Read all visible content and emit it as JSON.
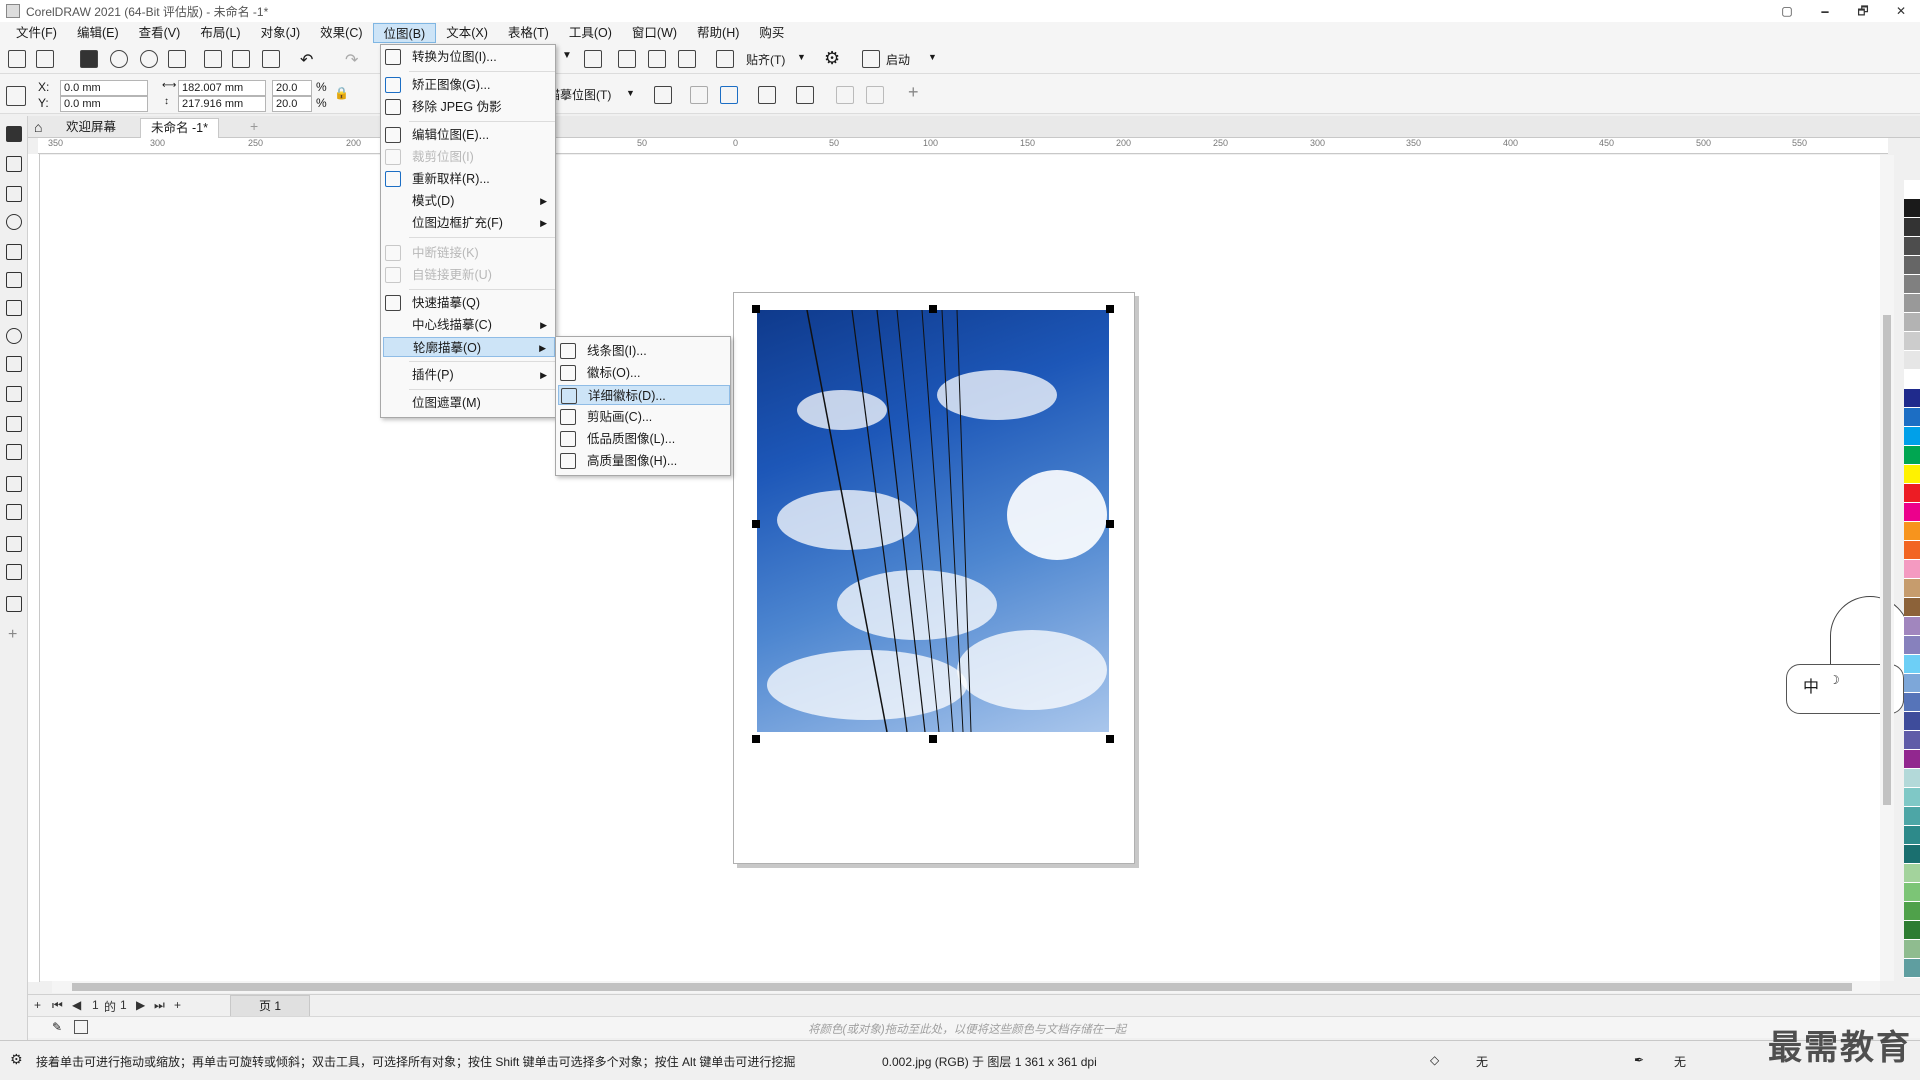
{
  "window": {
    "title": "CorelDRAW 2021 (64-Bit 评估版) - 未命名 -1*",
    "controls": [
      "🗕",
      "🗗",
      "✕"
    ]
  },
  "menubar": [
    "文件(F)",
    "编辑(E)",
    "查看(V)",
    "布局(L)",
    "对象(J)",
    "效果(C)",
    "位图(B)",
    "文本(X)",
    "表格(T)",
    "工具(O)",
    "窗口(W)",
    "帮助(H)",
    "购买"
  ],
  "toolbar1": {
    "snap_label": "贴齐(T)",
    "launch_label": "启动"
  },
  "toolbar2": {
    "x_label": "X:",
    "x_value": "0.0 mm",
    "y_label": "Y:",
    "y_value": "0.0 mm",
    "width_value": "182.007 mm",
    "height_value": "217.916 mm",
    "scale_x": "20.0",
    "scale_y": "20.0",
    "percent": "%",
    "trace_label": "描摹位图(T)"
  },
  "tabs": {
    "welcome": "欢迎屏幕",
    "document": "未命名 -1*"
  },
  "ruler_h": [
    "350",
    "300",
    "250",
    "200",
    "50",
    "0",
    "50",
    "100",
    "150",
    "200",
    "250",
    "300",
    "350",
    "400",
    "450",
    "500",
    "550"
  ],
  "bitmap_menu": {
    "items": [
      {
        "label": "转换为位图(I)...",
        "enabled": true
      },
      {
        "label": "矫正图像(G)...",
        "enabled": true
      },
      {
        "label": "移除 JPEG 伪影",
        "enabled": true
      },
      {
        "label": "编辑位图(E)...",
        "enabled": true
      },
      {
        "label": "裁剪位图(I)",
        "enabled": false
      },
      {
        "label": "重新取样(R)...",
        "enabled": true
      },
      {
        "label": "模式(D)",
        "enabled": true
      },
      {
        "label": "位图边框扩充(F)",
        "enabled": true
      },
      {
        "label": "中断链接(K)",
        "enabled": false
      },
      {
        "label": "自链接更新(U)",
        "enabled": false
      },
      {
        "label": "快速描摹(Q)",
        "enabled": true
      },
      {
        "label": "中心线描摹(C)",
        "enabled": true
      },
      {
        "label": "轮廓描摹(O)",
        "enabled": true
      },
      {
        "label": "插件(P)",
        "enabled": true
      },
      {
        "label": "位图遮罩(M)",
        "enabled": true
      }
    ]
  },
  "outline_submenu": {
    "items": [
      {
        "label": "线条图(I)..."
      },
      {
        "label": "徽标(O)..."
      },
      {
        "label": "详细徽标(D)..."
      },
      {
        "label": "剪贴画(C)..."
      },
      {
        "label": "低品质图像(L)..."
      },
      {
        "label": "高质量图像(H)..."
      }
    ]
  },
  "pagenav": {
    "current": "1",
    "of": "的",
    "total": "1",
    "page_tab": "页 1"
  },
  "colortray": {
    "hint": "将颜色(或对象)拖动至此处，以便将这些颜色与文档存储在一起"
  },
  "statusbar": {
    "hint": "接着单击可进行拖动或缩放；再单击可旋转或倾斜；双击工具，可选择所有对象；按住 Shift 键单击可选择多个对象；按住 Alt 键单击可进行挖掘",
    "info": "0.002.jpg (RGB) 于 图层 1 361 x 361 dpi",
    "fill": "无",
    "outline": "无"
  },
  "ime": {
    "label": "中"
  },
  "watermark": "最需教育",
  "colors": {
    "menu_highlight": "#cde4f7",
    "palette": [
      "#ffffff",
      "#1a1a1a",
      "#333333",
      "#4d4d4d",
      "#666666",
      "#808080",
      "#999999",
      "#b3b3b3",
      "#cccccc",
      "#e6e6e6",
      "#ffffff",
      "#1f2a8c",
      "#1c6ec4",
      "#00a0e9",
      "#00a651",
      "#fff200",
      "#ed1c24",
      "#ec008c",
      "#f7941d",
      "#f26522",
      "#f49ac1",
      "#c69c6d",
      "#8c6239",
      "#a186be",
      "#8781bd",
      "#6dcff6",
      "#7da7d9",
      "#5674b9",
      "#3e4c9b",
      "#605ca8",
      "#92278f",
      "#b3d9d9",
      "#7fc8c6",
      "#4da6a6",
      "#2d8a8a",
      "#1a6f6f",
      "#a3d39c",
      "#7cc576",
      "#4fa14a",
      "#2e7d32",
      "#8fbc8f",
      "#5f9ea0"
    ]
  }
}
